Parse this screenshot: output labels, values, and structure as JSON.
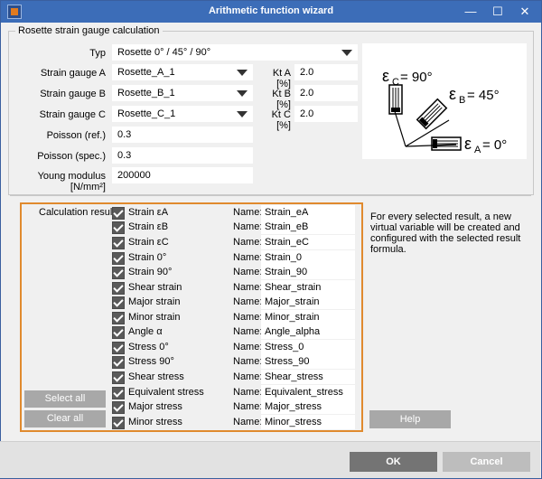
{
  "window": {
    "title": "Arithmetic function wizard",
    "minimize_glyph": "—",
    "maximize_glyph": "☐",
    "close_glyph": "✕"
  },
  "group": {
    "title": "Rosette strain gauge calculation"
  },
  "form": {
    "typ_label": "Typ",
    "typ_value": "Rosette 0° / 45° / 90°",
    "gauge_a_label": "Strain gauge A",
    "gauge_a_value": "Rosette_A_1",
    "gauge_b_label": "Strain gauge B",
    "gauge_b_value": "Rosette_B_1",
    "gauge_c_label": "Strain gauge C",
    "gauge_c_value": "Rosette_C_1",
    "kt_a_label": "Kt A [%]",
    "kt_a_value": "2.0",
    "kt_b_label": "Kt B [%]",
    "kt_b_value": "2.0",
    "kt_c_label": "Kt C [%]",
    "kt_c_value": "2.0",
    "poisson_ref_label": "Poisson (ref.)",
    "poisson_ref_value": "0.3",
    "poisson_spec_label": "Poisson (spec.)",
    "poisson_spec_value": "0.3",
    "young_label": "Young modulus [N/mm²]",
    "young_value": "200000"
  },
  "diagram": {
    "eps": "ε",
    "c_sub": "C",
    "c_angle": "= 90°",
    "b_sub": "B",
    "b_angle": "= 45°",
    "a_sub": "A",
    "a_angle": "= 0°"
  },
  "results": {
    "label": "Calculation results",
    "name_label": "Name:",
    "items": [
      {
        "label": "Strain εA",
        "name": "Strain_eA",
        "checked": true
      },
      {
        "label": "Strain εB",
        "name": "Strain_eB",
        "checked": true
      },
      {
        "label": "Strain εC",
        "name": "Strain_eC",
        "checked": true
      },
      {
        "label": "Strain 0°",
        "name": "Strain_0",
        "checked": true
      },
      {
        "label": "Strain 90°",
        "name": "Strain_90",
        "checked": true
      },
      {
        "label": "Shear strain",
        "name": "Shear_strain",
        "checked": true
      },
      {
        "label": "Major strain",
        "name": "Major_strain",
        "checked": true
      },
      {
        "label": "Minor strain",
        "name": "Minor_strain",
        "checked": true
      },
      {
        "label": "Angle α",
        "name": "Angle_alpha",
        "checked": true
      },
      {
        "label": "Stress 0°",
        "name": "Stress_0",
        "checked": true
      },
      {
        "label": "Stress 90°",
        "name": "Stress_90",
        "checked": true
      },
      {
        "label": "Shear stress",
        "name": "Shear_stress",
        "checked": true
      },
      {
        "label": "Equivalent stress",
        "name": "Equivalent_stress",
        "checked": true
      },
      {
        "label": "Major stress",
        "name": "Major_stress",
        "checked": true
      },
      {
        "label": "Minor stress",
        "name": "Minor_stress",
        "checked": true
      }
    ],
    "select_all": "Select all",
    "clear_all": "Clear all"
  },
  "info_text": "For every selected result, a new virtual variable will be created and configured with the selected result formula.",
  "help_button": "Help",
  "ok_button": "OK",
  "cancel_button": "Cancel"
}
